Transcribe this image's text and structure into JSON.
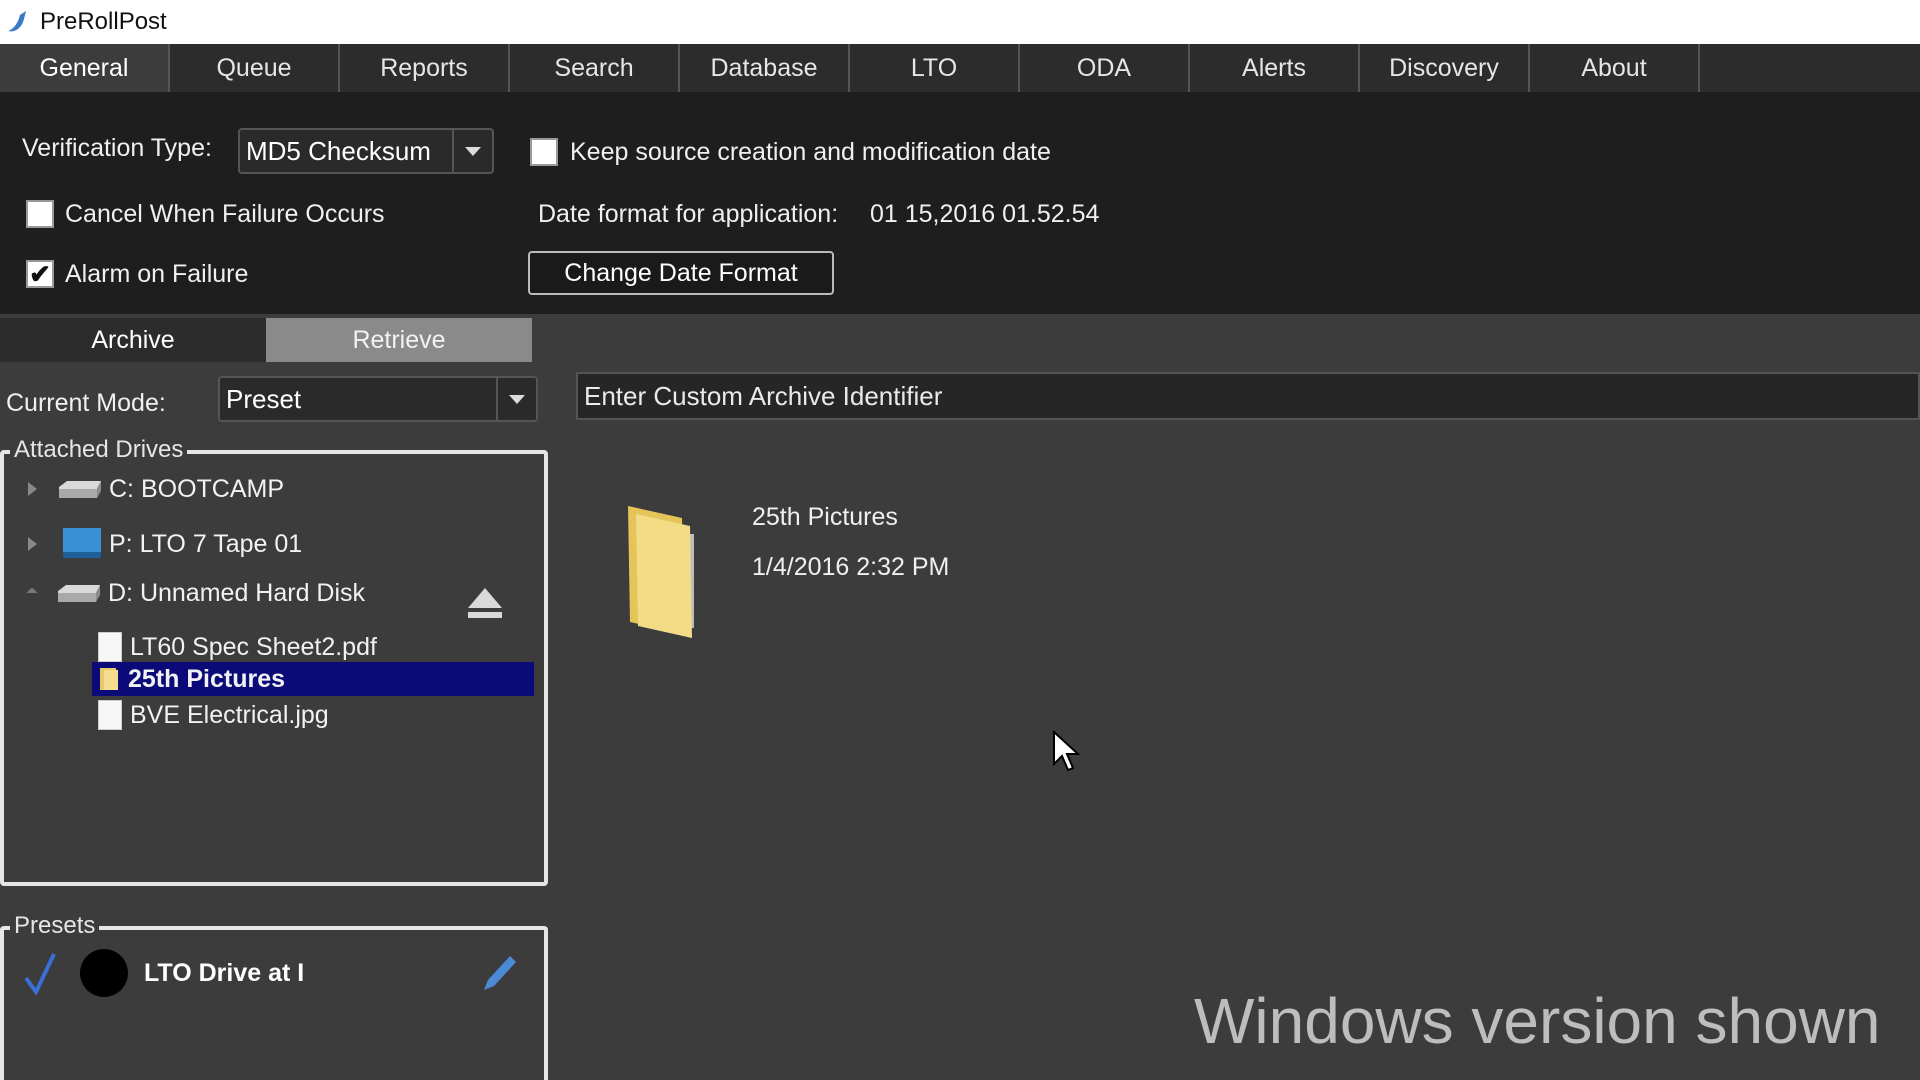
{
  "window": {
    "title": "PreRollPost"
  },
  "tabs": [
    {
      "label": "General",
      "active": true
    },
    {
      "label": "Queue"
    },
    {
      "label": "Reports"
    },
    {
      "label": "Search"
    },
    {
      "label": "Database"
    },
    {
      "label": "LTO"
    },
    {
      "label": "ODA"
    },
    {
      "label": "Alerts"
    },
    {
      "label": "Discovery"
    },
    {
      "label": "About"
    }
  ],
  "general": {
    "verification_label": "Verification Type:",
    "verification_value": "MD5 Checksum",
    "keep_dates_label": "Keep source creation and modification date",
    "keep_dates_checked": false,
    "cancel_failure_label": "Cancel When Failure Occurs",
    "cancel_failure_checked": false,
    "alarm_failure_label": "Alarm on Failure",
    "alarm_failure_checked": true,
    "alarm_check_glyph": "✔",
    "date_format_label": "Date format for application:",
    "date_format_value": "01 15,2016 01.52.54",
    "change_date_button": "Change Date Format"
  },
  "subtabs": [
    {
      "label": "Archive",
      "active": true
    },
    {
      "label": "Retrieve"
    }
  ],
  "archive": {
    "mode_label": "Current Mode:",
    "mode_value": "Preset",
    "identifier_placeholder": "Enter Custom Archive Identifier",
    "drives_label": "Attached Drives",
    "drives": [
      {
        "label": "C: BOOTCAMP",
        "icon": "hard-drive-icon"
      },
      {
        "label": "P: LTO 7 Tape 01",
        "icon": "tape-drive-icon"
      },
      {
        "label": "D: Unnamed Hard Disk",
        "icon": "hard-drive-icon",
        "expanded": true
      }
    ],
    "files": [
      {
        "label": "LT60 Spec Sheet2.pdf",
        "icon": "file-icon"
      },
      {
        "label": "25th Pictures",
        "icon": "folder-icon",
        "selected": true
      },
      {
        "label": "BVE Electrical.jpg",
        "icon": "file-icon"
      }
    ],
    "preview": {
      "name": "25th Pictures",
      "date": "1/4/2016 2:32 PM"
    },
    "presets_label": "Presets",
    "preset": {
      "name": "LTO Drive at I"
    }
  },
  "watermark": "Windows version shown",
  "colors": {
    "selection": "#0a0a78",
    "background": "#3c3c3c",
    "panel": "#1e1e1e",
    "preset_check": "#3a6fd8"
  }
}
